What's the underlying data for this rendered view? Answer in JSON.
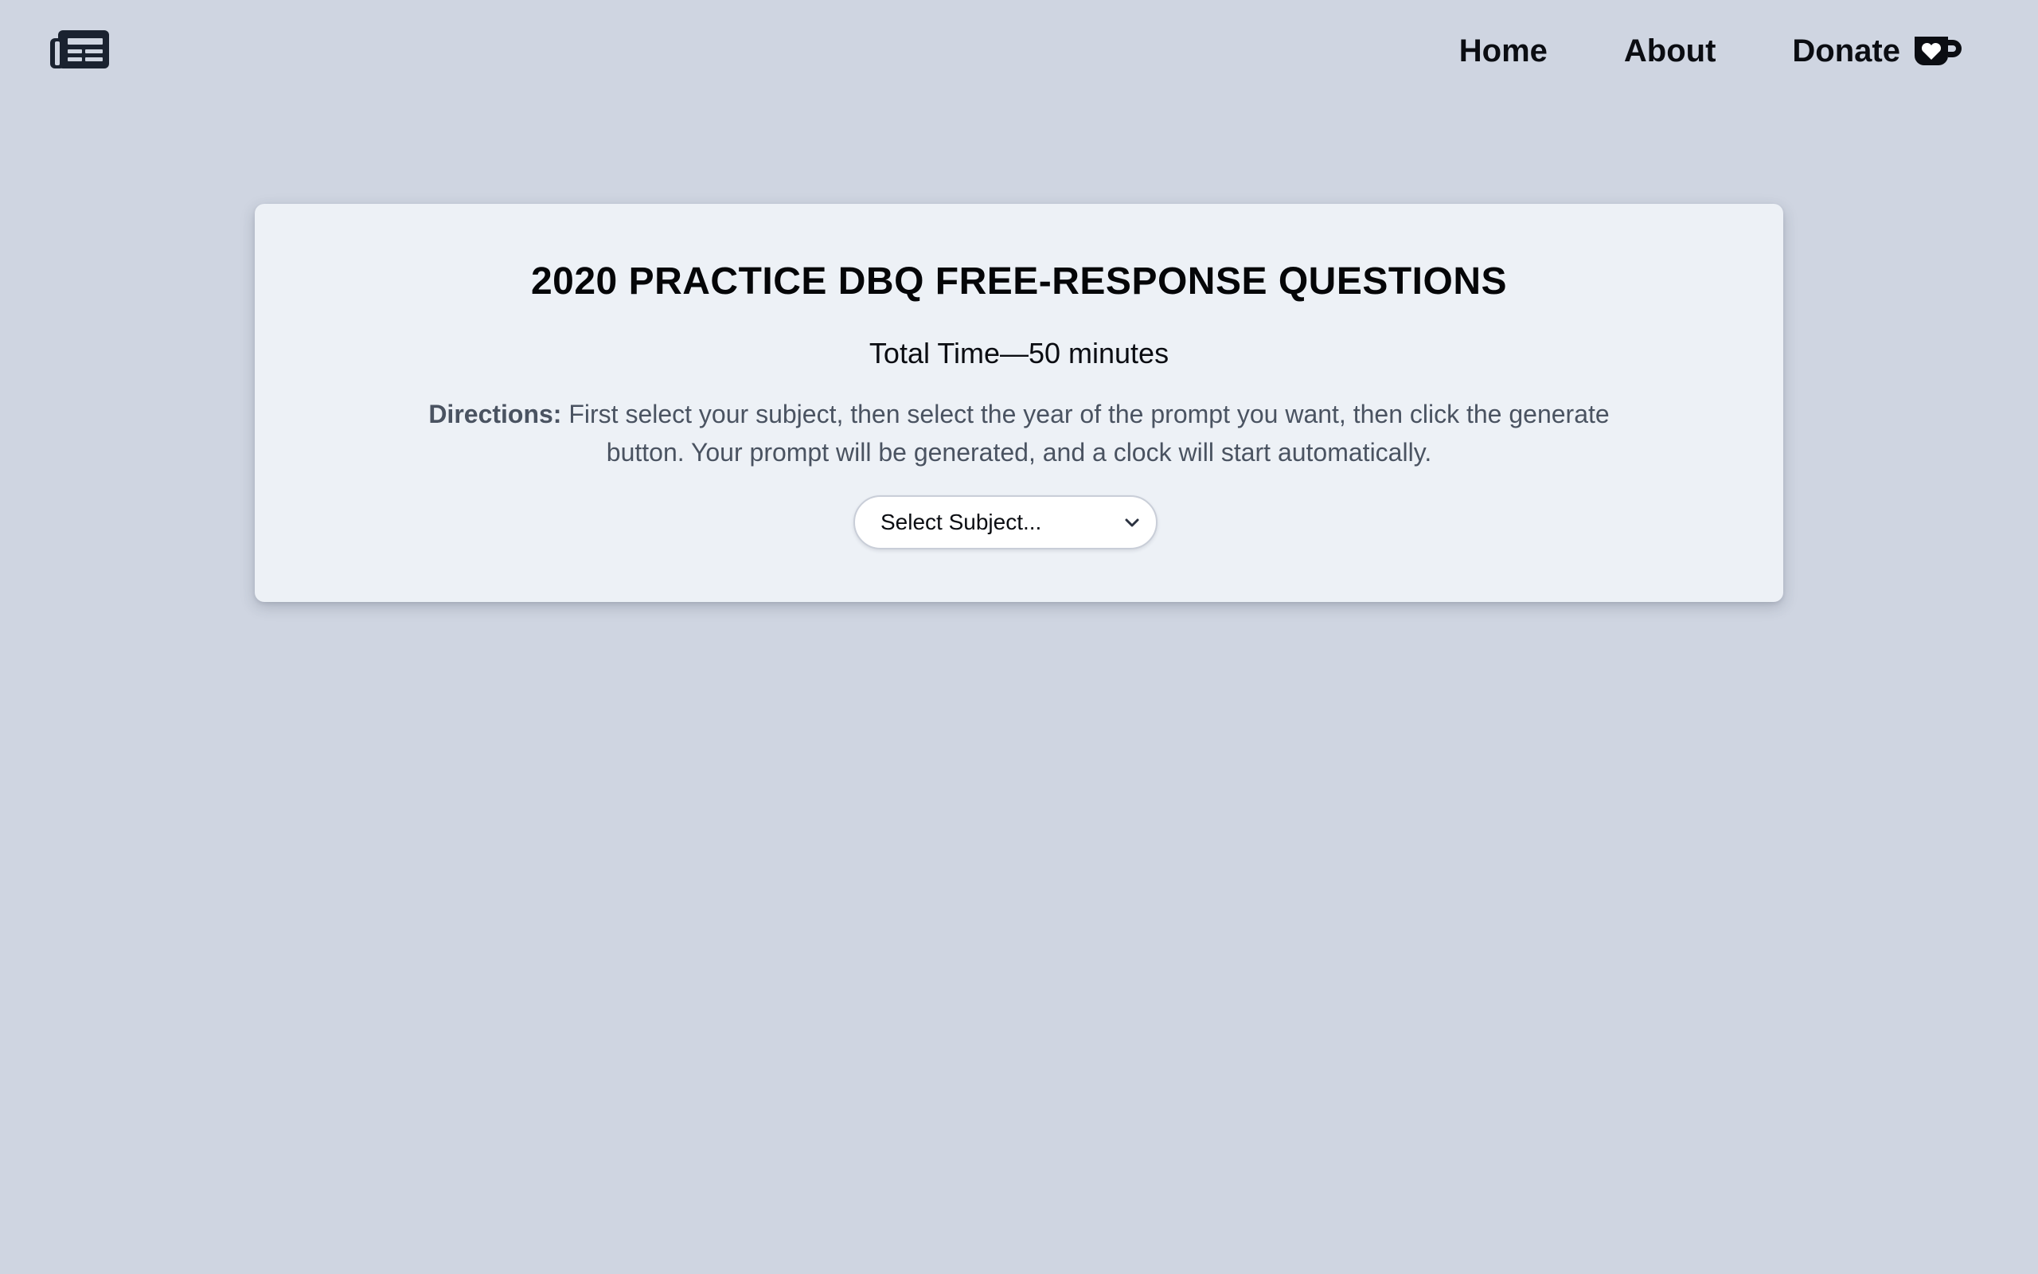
{
  "header": {
    "logo_icon": "newspaper-icon",
    "nav": [
      {
        "label": "Home"
      },
      {
        "label": "About"
      },
      {
        "label": "Donate",
        "icon": "coffee-heart-icon"
      }
    ]
  },
  "card": {
    "title": "2020 PRACTICE DBQ FREE-RESPONSE QUESTIONS",
    "time": "Total Time—50 minutes",
    "directions_label": "Directions:",
    "directions_text": " First select your subject, then select the year of the prompt you want, then click the generate button. Your prompt will be generated, and a clock will start automatically.",
    "subject_select": {
      "selected": "Select Subject...",
      "icon": "chevron-down-icon"
    }
  },
  "colors": {
    "page_background": "#cfd5e1",
    "card_background": "#edf1f6",
    "icon_dark": "#1a2230",
    "directions_text": "#4a5361"
  }
}
